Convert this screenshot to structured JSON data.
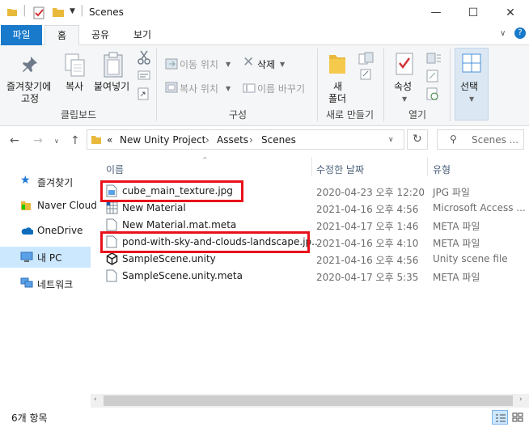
{
  "window": {
    "title": "Scenes",
    "min_label": "—",
    "max_label": "☐",
    "close_label": "✕"
  },
  "ribbon_tabs": [
    "파일",
    "홈",
    "공유",
    "보기"
  ],
  "ribbon": {
    "clipboard": {
      "pin": "즐겨찾기에",
      "pin2": "고정",
      "copy": "복사",
      "paste": "붙여넣기",
      "label": "클립보드"
    },
    "organize": {
      "move_to": "이동 위치",
      "copy_to": "복사 위치",
      "delete": "삭제",
      "rename": "이름 바꾸기",
      "label": "구성"
    },
    "new": {
      "new_folder1": "새",
      "new_folder2": "폴더",
      "label": "새로 만들기"
    },
    "open": {
      "properties": "속성",
      "label": "열기"
    },
    "select": {
      "select": "선택"
    }
  },
  "address": {
    "prefix": "«",
    "crumbs": [
      "New Unity Project",
      "Assets",
      "Scenes"
    ],
    "search_placeholder": "Scenes ..."
  },
  "nav": {
    "items": [
      {
        "label": "즐겨찾기",
        "icon": "star-icon"
      },
      {
        "label": "Naver Cloud",
        "icon": "folder-icon"
      },
      {
        "label": "OneDrive",
        "icon": "cloud-icon"
      },
      {
        "label": "내 PC",
        "icon": "computer-icon"
      },
      {
        "label": "네트워크",
        "icon": "network-icon"
      }
    ]
  },
  "columns": {
    "name": "이름",
    "date": "수정한 날짜",
    "type": "유형"
  },
  "files": [
    {
      "name": "cube_main_texture.jpg",
      "date": "2020-04-23 오후 12:20",
      "type": "JPG 파일",
      "icon": "image-file-icon"
    },
    {
      "name": "New Material",
      "date": "2021-04-16 오후 4:56",
      "type": "Microsoft Access ...",
      "icon": "material-file-icon"
    },
    {
      "name": "New Material.mat.meta",
      "date": "2021-04-17 오후 1:46",
      "type": "META 파일",
      "icon": "document-file-icon"
    },
    {
      "name": "pond-with-sky-and-clouds-landscape.jp...",
      "date": "2021-04-16 오후 4:10",
      "type": "META 파일",
      "icon": "document-file-icon"
    },
    {
      "name": "SampleScene.unity",
      "date": "2021-04-16 오후 4:56",
      "type": "Unity scene file",
      "icon": "unity-icon"
    },
    {
      "name": "SampleScene.unity.meta",
      "date": "2020-04-17 오후 5:35",
      "type": "META 파일",
      "icon": "document-file-icon"
    }
  ],
  "status": {
    "count": "6개 항목"
  },
  "colors": {
    "file_tab": "#1979ca",
    "selection": "#cce8ff",
    "highlight_box": "#e8121c"
  }
}
